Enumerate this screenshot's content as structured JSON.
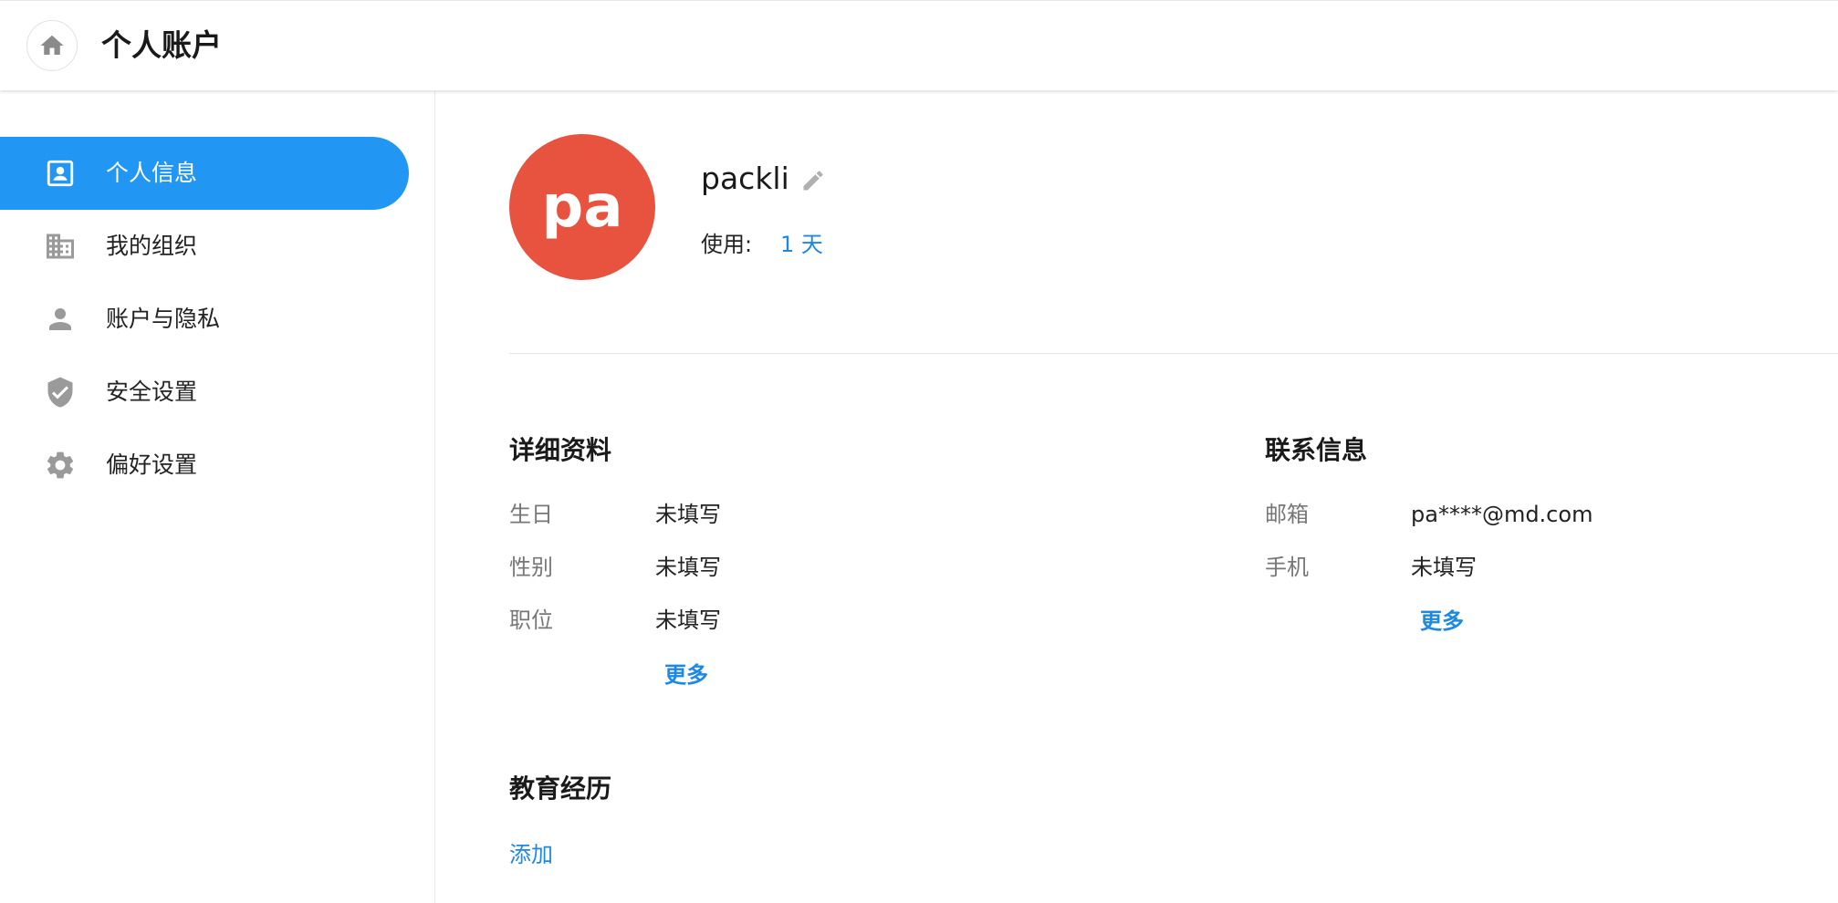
{
  "header": {
    "title": "个人账户",
    "home_icon": "home-icon"
  },
  "sidebar": {
    "items": [
      {
        "label": "个人信息",
        "icon": "contact-card-icon",
        "active": true
      },
      {
        "label": "我的组织",
        "icon": "building-icon",
        "active": false
      },
      {
        "label": "账户与隐私",
        "icon": "person-icon",
        "active": false
      },
      {
        "label": "安全设置",
        "icon": "shield-check-icon",
        "active": false
      },
      {
        "label": "偏好设置",
        "icon": "gear-icon",
        "active": false
      }
    ]
  },
  "profile": {
    "avatar_text": "pa",
    "avatar_color": "#e8533f",
    "username": "packli",
    "usage_label": "使用:",
    "usage_value": "1 天"
  },
  "details": {
    "title": "详细资料",
    "fields": [
      {
        "label": "生日",
        "value": "未填写"
      },
      {
        "label": "性别",
        "value": "未填写"
      },
      {
        "label": "职位",
        "value": "未填写"
      }
    ],
    "more": "更多"
  },
  "contact": {
    "title": "联系信息",
    "fields": [
      {
        "label": "邮箱",
        "value": "pa****@md.com"
      },
      {
        "label": "手机",
        "value": "未填写"
      }
    ],
    "more": "更多"
  },
  "education": {
    "title": "教育经历",
    "add": "添加"
  },
  "colors": {
    "accent": "#2196f3",
    "link": "#1e88e5"
  }
}
